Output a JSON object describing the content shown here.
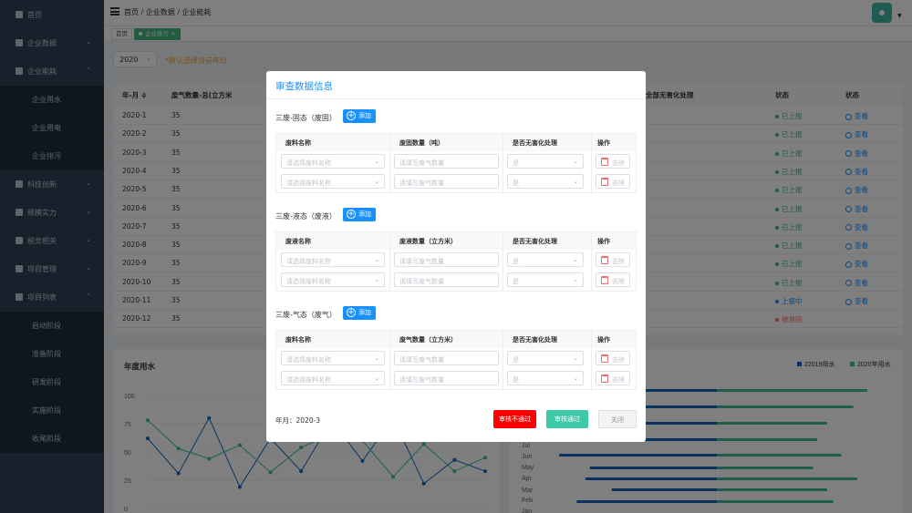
{
  "sidebar": {
    "items": [
      {
        "label": "首页",
        "chevron": ""
      },
      {
        "label": "企业数据",
        "chevron": "⌄"
      },
      {
        "label": "企业能耗",
        "chevron": "⌃"
      },
      {
        "label": "企业用水",
        "sub": true
      },
      {
        "label": "企业用电",
        "sub": true
      },
      {
        "label": "企业排污",
        "sub": true
      },
      {
        "label": "科技创新",
        "chevron": "⌄"
      },
      {
        "label": "规模实力",
        "chevron": "⌄"
      },
      {
        "label": "税务相关",
        "chevron": "⌄"
      },
      {
        "label": "项目管理",
        "chevron": "⌄"
      },
      {
        "label": "项目列表",
        "chevron": "⌃"
      },
      {
        "label": "启动阶段",
        "sub": true
      },
      {
        "label": "准备阶段",
        "sub": true
      },
      {
        "label": "研发阶段",
        "sub": true
      },
      {
        "label": "实施阶段",
        "sub": true
      },
      {
        "label": "收尾阶段",
        "sub": true
      }
    ]
  },
  "header": {
    "breadcrumb": "首页 / 企业数据 / 企业能耗",
    "avatar_caret": "▼"
  },
  "tags": [
    {
      "label": "首页"
    },
    {
      "label": "企业排污",
      "close": "×"
    }
  ],
  "filter": {
    "year": "2020",
    "hint": "*默认选择当前年份"
  },
  "table": {
    "headers": [
      "年-月 ≑",
      "废气数量-总(立方米",
      "全部无害化处理",
      "状态",
      "状态"
    ],
    "rows": [
      {
        "month": "2020-1",
        "value": "35",
        "status": "已上报",
        "action": "查看"
      },
      {
        "month": "2020-2",
        "value": "35",
        "status": "已上报",
        "action": "查看"
      },
      {
        "month": "2020-3",
        "value": "35",
        "status": "已上报",
        "action": "查看"
      },
      {
        "month": "2020-4",
        "value": "35",
        "status": "已上报",
        "action": "查看"
      },
      {
        "month": "2020-5",
        "value": "35",
        "status": "已上报",
        "action": "查看"
      },
      {
        "month": "2020-6",
        "value": "35",
        "status": "已上报",
        "action": "查看"
      },
      {
        "month": "2020-7",
        "value": "35",
        "status": "已上报",
        "action": "查看"
      },
      {
        "month": "2020-8",
        "value": "35",
        "status": "已上报",
        "action": "查看"
      },
      {
        "month": "2020-9",
        "value": "35",
        "status": "已上报",
        "action": "查看"
      },
      {
        "month": "2020-10",
        "value": "35",
        "status": "已上报",
        "action": "查看"
      },
      {
        "month": "2020-11",
        "value": "35",
        "status": "上报中",
        "action": "查看"
      },
      {
        "month": "2020-12",
        "value": "35",
        "status": "被退回",
        "action": ""
      }
    ]
  },
  "colors": {
    "sidebar": "#304156",
    "primary": "#1890ff",
    "success": "#42b983",
    "danger": "#f56c6c",
    "blue_series": "#1565c0",
    "green_series": "#3dbf94"
  },
  "chart_data": [
    {
      "type": "line",
      "title": "年度用水",
      "ylim": [
        0,
        100
      ],
      "yticks": [
        "100",
        "75",
        "50",
        "25",
        "0"
      ],
      "series": [
        {
          "name": "",
          "values": [
            62,
            31,
            80,
            19,
            62,
            33,
            78,
            42,
            80,
            22,
            43,
            33
          ]
        },
        {
          "name": "",
          "values": [
            78,
            53,
            44,
            56,
            32,
            54,
            66,
            60,
            28,
            57,
            33,
            45
          ]
        }
      ]
    },
    {
      "type": "bar",
      "legend": [
        "22019用水",
        "2020年用水"
      ],
      "categories": [
        "Jul",
        "Jun",
        "May",
        "Apr",
        "Mar",
        "Feb",
        "Jan"
      ],
      "series": [
        {
          "name": "22019用水",
          "values": [
            62,
            35,
            68,
            40,
            72,
            58,
            60,
            48,
            64
          ]
        },
        {
          "name": "2020年用水",
          "values": [
            75,
            68,
            55,
            50,
            62,
            48,
            70,
            55,
            58
          ]
        }
      ]
    }
  ],
  "modal": {
    "title": "审查数据信息",
    "add_label": "添加",
    "sections": [
      {
        "title": "三废-固态（废固）",
        "cols": [
          "废料名称",
          "废固数量（吨）",
          "是否无害化处理",
          "操作"
        ],
        "rows": [
          {
            "name_ph": "请选择废料名称",
            "qty_ph": "请填写废气数量",
            "harmless": "是",
            "del": "去除"
          },
          {
            "name_ph": "请选择废料名称",
            "qty_ph": "请填写废气数量",
            "harmless": "是",
            "del": "去除"
          }
        ]
      },
      {
        "title": "三废-液态（废液）",
        "cols": [
          "废液名称",
          "废液数量（立方米）",
          "是否无害化处理",
          "操作"
        ],
        "rows": [
          {
            "name_ph": "请选择废料名称",
            "qty_ph": "请填写废气数量",
            "harmless": "是",
            "del": "去除"
          },
          {
            "name_ph": "请选择废料名称",
            "qty_ph": "请填写废气数量",
            "harmless": "是",
            "del": "去除"
          }
        ]
      },
      {
        "title": "三废-气态（废气）",
        "cols": [
          "废料名称",
          "废气数量（立方米）",
          "是否无害化处理",
          "操作"
        ],
        "rows": [
          {
            "name_ph": "请选择废料名称",
            "qty_ph": "请填写废气数量",
            "harmless": "是",
            "del": "去除"
          },
          {
            "name_ph": "请选择废料名称",
            "qty_ph": "请填写废气数量",
            "harmless": "是",
            "del": "去除"
          }
        ]
      }
    ],
    "year_month": "年月：2020-3",
    "reject_label": "审核不通过",
    "approve_label": "审核通过",
    "close_label": "关闭"
  }
}
